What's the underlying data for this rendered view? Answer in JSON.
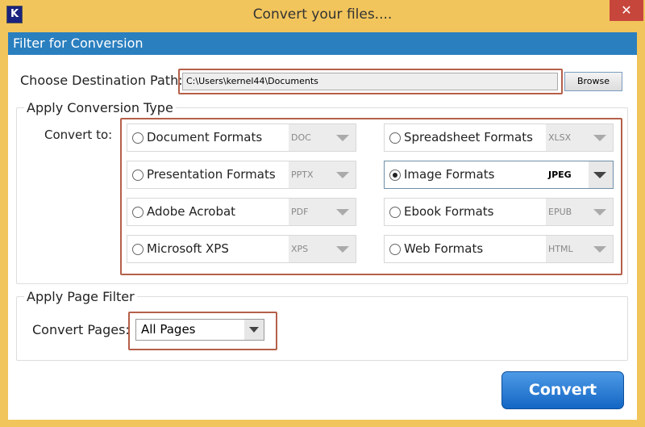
{
  "window": {
    "title": "Convert your files....",
    "logo": "K",
    "close": "✕"
  },
  "header": "Filter for Conversion",
  "destination": {
    "label": "Choose Destination Path:",
    "value": "C:\\Users\\kernel44\\Documents",
    "browse": "Browse"
  },
  "conversion": {
    "group": "Apply Conversion Type",
    "label": "Convert to:",
    "options": [
      {
        "name": "Document Formats",
        "format": "DOC",
        "selected": false
      },
      {
        "name": "Spreadsheet Formats",
        "format": "XLSX",
        "selected": false
      },
      {
        "name": "Presentation Formats",
        "format": "PPTX",
        "selected": false
      },
      {
        "name": "Image Formats",
        "format": "JPEG",
        "selected": true
      },
      {
        "name": "Adobe Acrobat",
        "format": "PDF",
        "selected": false
      },
      {
        "name": "Ebook Formats",
        "format": "EPUB",
        "selected": false
      },
      {
        "name": "Microsoft XPS",
        "format": "XPS",
        "selected": false
      },
      {
        "name": "Web Formats",
        "format": "HTML",
        "selected": false
      }
    ]
  },
  "page_filter": {
    "group": "Apply Page Filter",
    "label": "Convert Pages:",
    "value": "All Pages"
  },
  "convert": "Convert"
}
